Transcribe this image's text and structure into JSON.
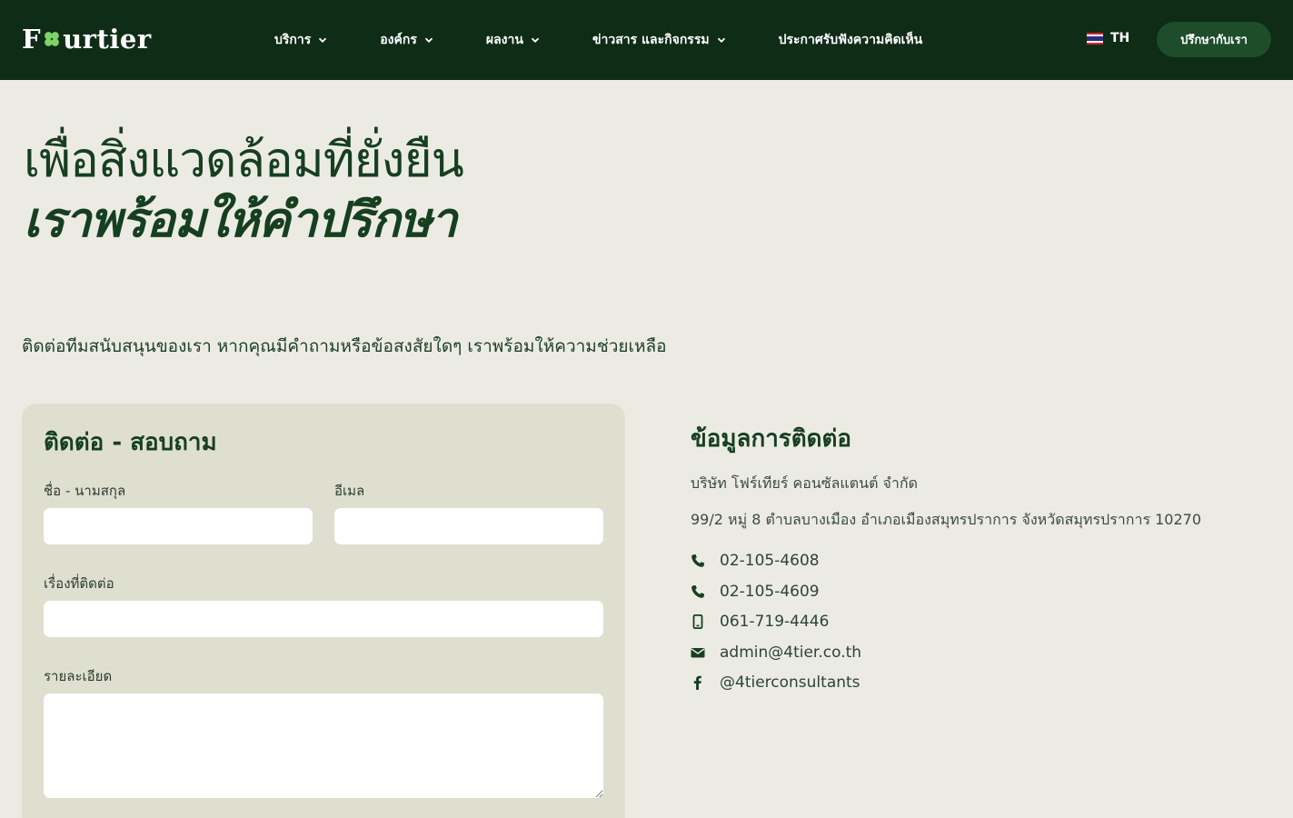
{
  "header": {
    "logo_prefix": "F",
    "logo_suffix": "urtier",
    "nav": [
      {
        "label": "บริการ",
        "has_dropdown": true
      },
      {
        "label": "องค์กร",
        "has_dropdown": true
      },
      {
        "label": "ผลงาน",
        "has_dropdown": true
      },
      {
        "label": "ข่าวสาร และกิจกรรม",
        "has_dropdown": true
      },
      {
        "label": "ประกาศรับฟังความคิดเห็น",
        "has_dropdown": false
      }
    ],
    "language": "TH",
    "cta_label": "ปรึกษากับเรา"
  },
  "hero": {
    "line1": "เพื่อสิ่งแวดล้อมที่ยั่งยืน",
    "line2": "เราพร้อมให้คำปรึกษา"
  },
  "intro": "ติดต่อทีมสนับสนุนของเรา หากคุณมีคำถามหรือข้อสงสัยใดๆ เราพร้อมให้ความช่วยเหลือ",
  "form": {
    "title": "ติดต่อ - สอบถาม",
    "name_label": "ชื่อ - นามสกุล",
    "email_label": "อีเมล",
    "subject_label": "เรื่องที่ติดต่อ",
    "details_label": "รายละเอียด",
    "name_value": "",
    "email_value": "",
    "subject_value": "",
    "details_value": ""
  },
  "contact": {
    "title": "ข้อมูลการติดต่อ",
    "company": "บริษัท โฟร์เทียร์ คอนซัลแตนต์ จำกัด",
    "address": "99/2 หมู่ 8 ตำบลบางเมือง อำเภอเมืองสมุทรปราการ จังหวัดสมุทรปราการ 10270",
    "items": [
      {
        "icon": "phone-icon",
        "text": "02-105-4608"
      },
      {
        "icon": "phone-icon",
        "text": "02-105-4609"
      },
      {
        "icon": "mobile-icon",
        "text": "061-719-4446"
      },
      {
        "icon": "email-icon",
        "text": "admin@4tier.co.th"
      },
      {
        "icon": "facebook-icon",
        "text": "@4tierconsultants"
      }
    ]
  },
  "colors": {
    "header_bg": "#0f2c17",
    "page_bg": "#ecebe3",
    "card_bg": "#dfdfcf",
    "brand_green": "#163f20",
    "cta_bg": "#1d4d2a",
    "clover": "#7fd36a"
  }
}
